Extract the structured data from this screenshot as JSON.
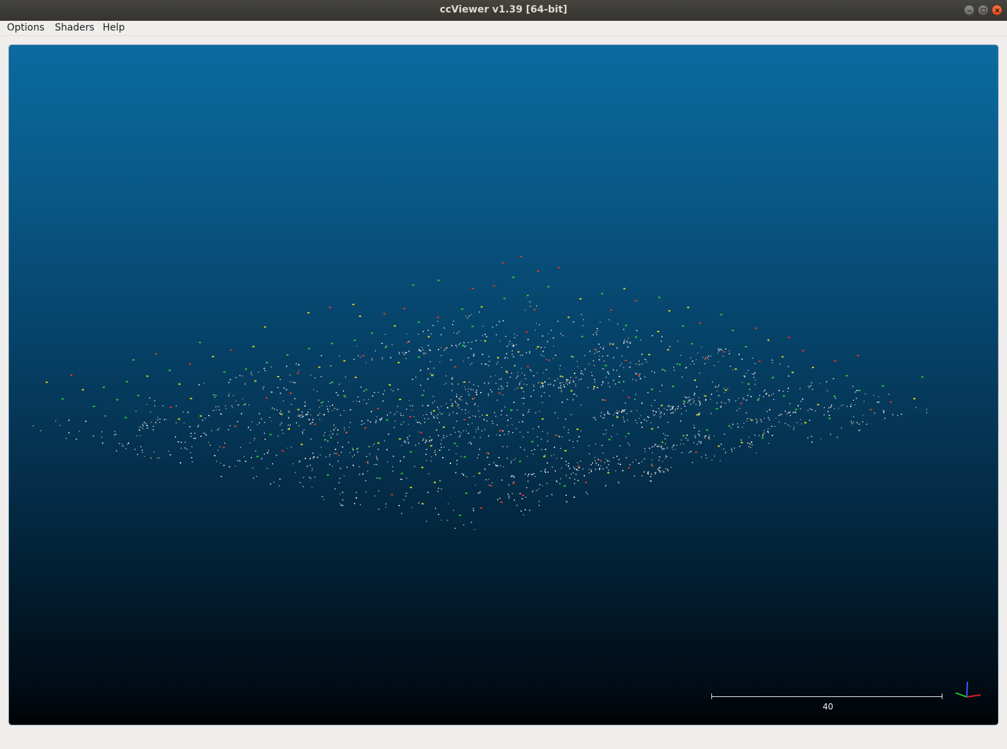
{
  "window": {
    "title": "ccViewer v1.39 [64-bit]"
  },
  "menubar": {
    "items": [
      "Options",
      "Shaders",
      "Help"
    ]
  },
  "viewport": {
    "background_top": "#0b6aa0",
    "background_bottom": "#000305",
    "point_color": "#e8e8e8",
    "camera_colors": [
      "#2bd12b",
      "#e03a1c",
      "#d6d61a"
    ],
    "scale_bar": {
      "label": "40"
    },
    "axes_colors": {
      "x": "#e02020",
      "y": "#20d020",
      "z": "#3060ff"
    }
  }
}
